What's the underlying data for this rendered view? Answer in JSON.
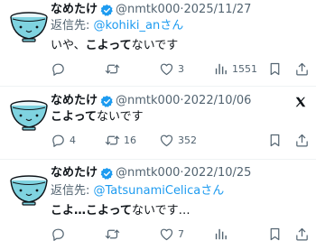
{
  "tweets": [
    {
      "name": "なめたけ",
      "handle": "@nmtk000",
      "sep": "·",
      "date": "2025/11/27",
      "reply_label": "返信先: ",
      "reply_mention": "@kohiki_an",
      "reply_suffix": "さん",
      "text_pre": "いや、",
      "text_bold": "こよって",
      "text_post": "ないです",
      "replies": "",
      "retweets": "",
      "likes": "3",
      "views": "1551"
    },
    {
      "name": "なめたけ",
      "handle": "@nmtk000",
      "sep": "·",
      "date": "2022/10/06",
      "text_pre": "",
      "text_bold": "こよって",
      "text_post": "ないです",
      "replies": "4",
      "retweets": "16",
      "likes": "352",
      "views": ""
    },
    {
      "name": "なめたけ",
      "handle": "@nmtk000",
      "sep": "·",
      "date": "2022/10/25",
      "reply_label": "返信先: ",
      "reply_mention": "@TatsunamiCelica",
      "reply_suffix": "さん",
      "text_pre": "",
      "text_bold": "こよ…こよって",
      "text_post": "ないです…",
      "replies": "",
      "retweets": "",
      "likes": "7",
      "views": ""
    }
  ],
  "colors": {
    "accent": "#1d9bf0",
    "secondary_text": "#536471",
    "avatar_bowl": "#7fd3e0"
  },
  "icons": [
    "bowl-avatar-icon",
    "verified-badge-icon",
    "reply-icon",
    "retweet-icon",
    "like-icon",
    "views-icon",
    "bookmark-icon",
    "share-icon",
    "x-logo-icon"
  ]
}
